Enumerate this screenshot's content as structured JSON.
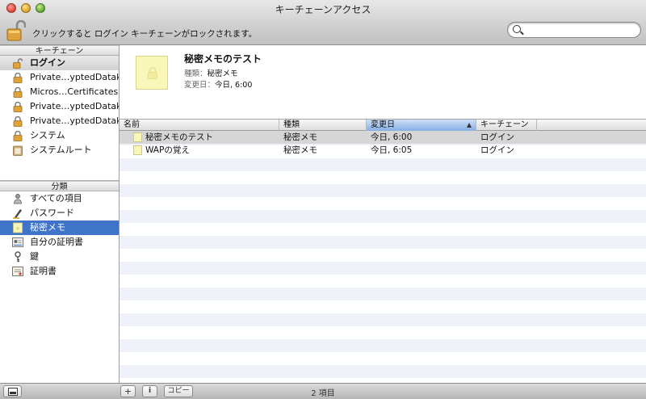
{
  "window": {
    "title": "キーチェーンアクセス"
  },
  "toolbar": {
    "lock_text": "クリックすると ログイン キーチェーンがロックされます。",
    "search_placeholder": "",
    "search_icon": "magnifier-icon",
    "lock_icon": "open-padlock-icon"
  },
  "sidebar": {
    "keychains_header": "キーチェーン",
    "keychains": [
      {
        "label": "ログイン",
        "icon": "open-padlock-icon",
        "selected": true
      },
      {
        "label": "Private…yptedDatak",
        "icon": "padlock-icon"
      },
      {
        "label": "Micros…Certificates",
        "icon": "padlock-icon"
      },
      {
        "label": "Private…yptedDatak",
        "icon": "padlock-icon"
      },
      {
        "label": "Private…yptedDatak",
        "icon": "padlock-icon"
      },
      {
        "label": "システム",
        "icon": "padlock-icon"
      },
      {
        "label": "システムルート",
        "icon": "cabinet-icon"
      }
    ],
    "categories_header": "分類",
    "categories": [
      {
        "label": "すべての項目",
        "icon": "people-icon"
      },
      {
        "label": "パスワード",
        "icon": "pen-icon"
      },
      {
        "label": "秘密メモ",
        "icon": "note-icon",
        "selected": true
      },
      {
        "label": "自分の証明書",
        "icon": "certificate-person-icon"
      },
      {
        "label": "鍵",
        "icon": "key-icon"
      },
      {
        "label": "証明書",
        "icon": "certificate-icon"
      }
    ]
  },
  "detail": {
    "title": "秘密メモのテスト",
    "kind_label": "種類：",
    "kind_value": "秘密メモ",
    "modified_label": "変更日：",
    "modified_value": "今日, 6:00"
  },
  "table": {
    "columns": [
      "名前",
      "種類",
      "変更日",
      "キーチェーン"
    ],
    "sorted_column": "変更日",
    "rows": [
      {
        "name": "秘密メモのテスト",
        "kind": "秘密メモ",
        "modified": "今日, 6:00",
        "keychain": "ログイン",
        "selected": true
      },
      {
        "name": "WAPの覚え",
        "kind": "秘密メモ",
        "modified": "今日, 6:05",
        "keychain": "ログイン"
      }
    ]
  },
  "bottombar": {
    "add_label": "+",
    "info_label": "i",
    "copy_label": "コピー",
    "count_text": "2 項目"
  },
  "colors": {
    "selection_blue": "#3f74c9",
    "note_yellow": "#f8f6b8",
    "sorted_header": "#86aee4"
  }
}
